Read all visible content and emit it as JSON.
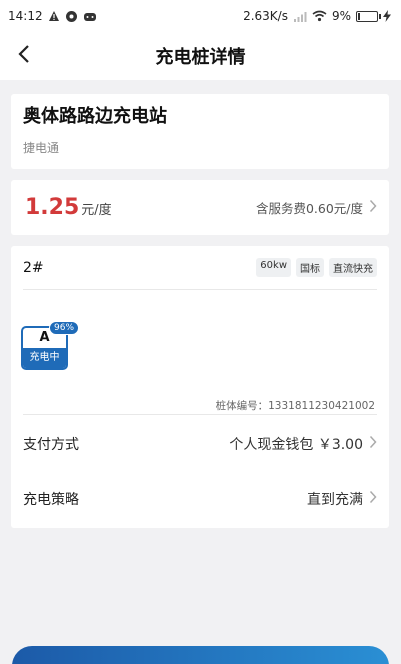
{
  "status_bar": {
    "time": "14:12",
    "network_speed": "2.63K/s",
    "battery_percent": "9%",
    "battery_level": 0.09,
    "icons": [
      "warning-icon",
      "notification-icon",
      "game-icon",
      "signal-icon",
      "wifi-icon",
      "battery-icon",
      "charging-icon"
    ]
  },
  "header": {
    "title": "充电桩详情",
    "back_icon": "chevron-left-icon"
  },
  "station": {
    "name": "奥体路路边充电站",
    "operator": "捷电通"
  },
  "price": {
    "value": "1.25",
    "unit": "元/度",
    "service_fee": "含服务费0.60元/度"
  },
  "pile": {
    "number": "2#",
    "tags": [
      "60kw",
      "国标",
      "直流快充"
    ],
    "connector": {
      "label": "A",
      "status": "充电中",
      "percent": "96%"
    },
    "serial": "桩体编号：1331811230421002"
  },
  "payment": {
    "label": "支付方式",
    "value": "个人现金钱包 ￥3.00"
  },
  "strategy": {
    "label": "充电策略",
    "value": "直到充满"
  },
  "colors": {
    "price": "#d23a3a",
    "accent": "#1f6bb8"
  }
}
